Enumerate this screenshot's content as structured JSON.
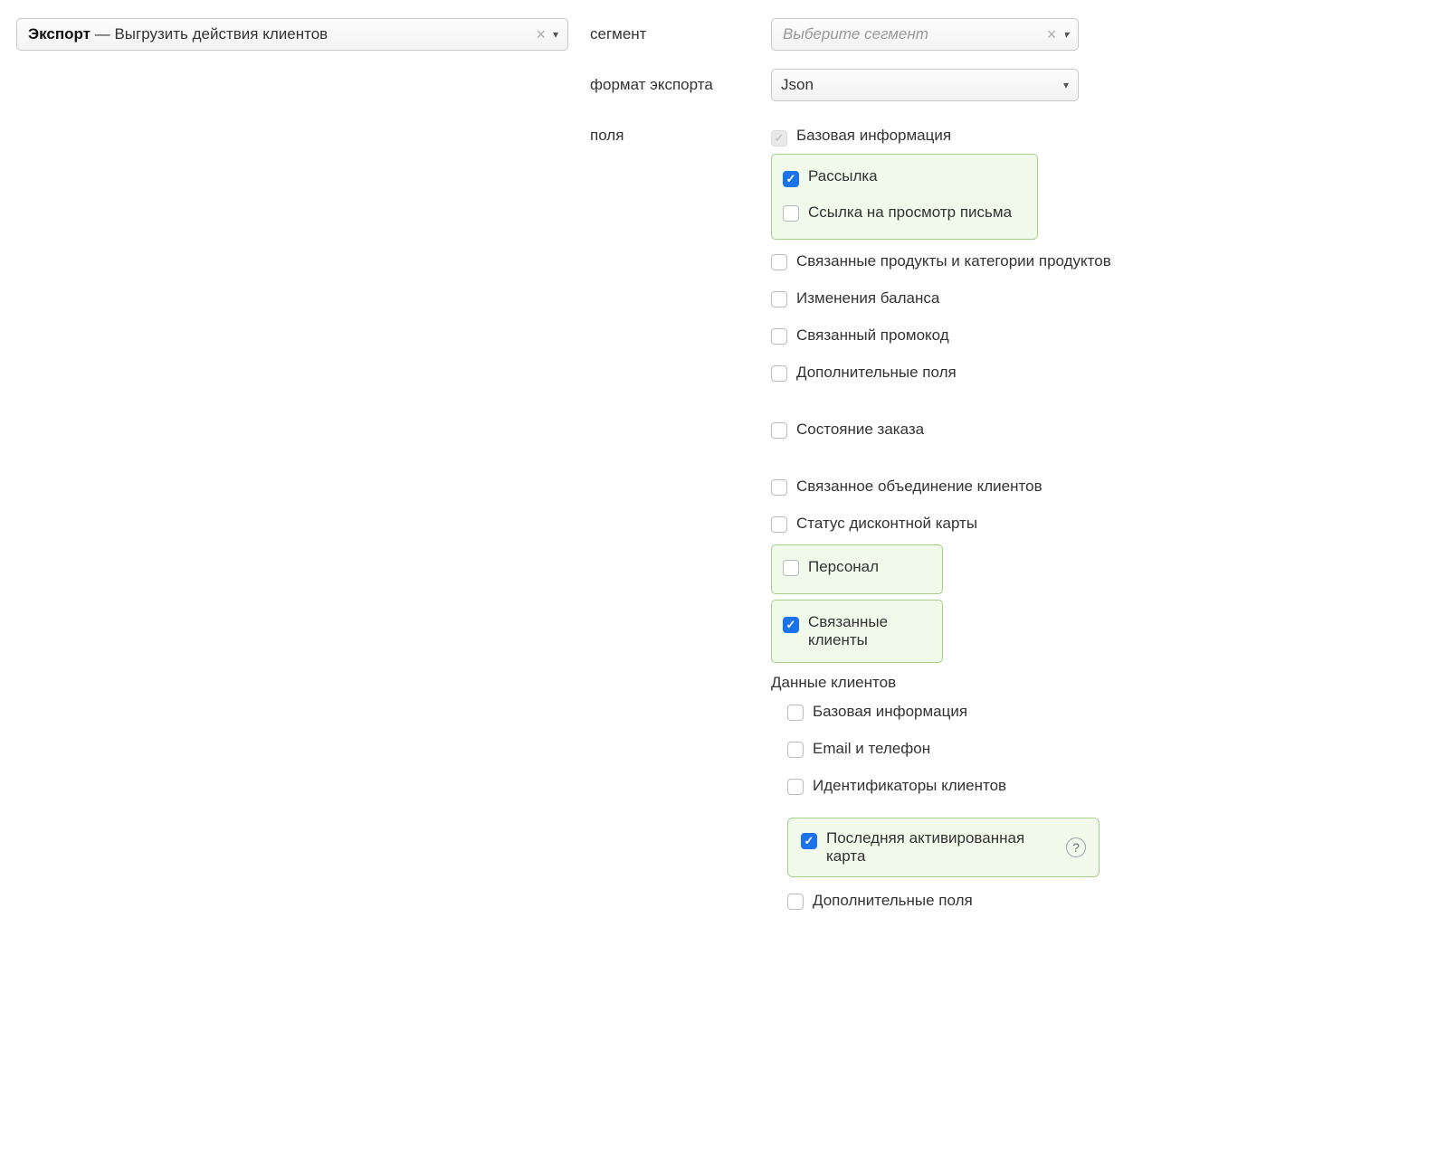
{
  "topSelect": {
    "bold": "Экспорт",
    "separator": " — ",
    "rest": "Выгрузить действия клиентов"
  },
  "labels": {
    "segment": "сегмент",
    "exportFormat": "формат экспорта",
    "fields": "поля"
  },
  "segment": {
    "placeholder": "Выберите сегмент"
  },
  "format": {
    "value": "Json"
  },
  "fields": {
    "base": "Базовая информация",
    "mailing": "Рассылка",
    "mailingSub": "Ссылка на просмотр письма",
    "products": "Связанные продукты и категории продуктов",
    "balance": "Изменения баланса",
    "promo": "Связанный промокод",
    "extra1": "Дополнительные поля",
    "orderState": "Состояние заказа",
    "union": "Связанное объединение клиентов",
    "discount": "Статус дисконтной карты",
    "personnel": "Персонал",
    "relatedClients": "Связанные клиенты",
    "clientsDataTitle": "Данные клиентов",
    "cd_base": "Базовая информация",
    "cd_email": "Email и телефон",
    "cd_ids": "Идентификаторы клиентов",
    "cd_lastCard": "Последняя активированная карта",
    "cd_extra": "Дополнительные поля"
  }
}
